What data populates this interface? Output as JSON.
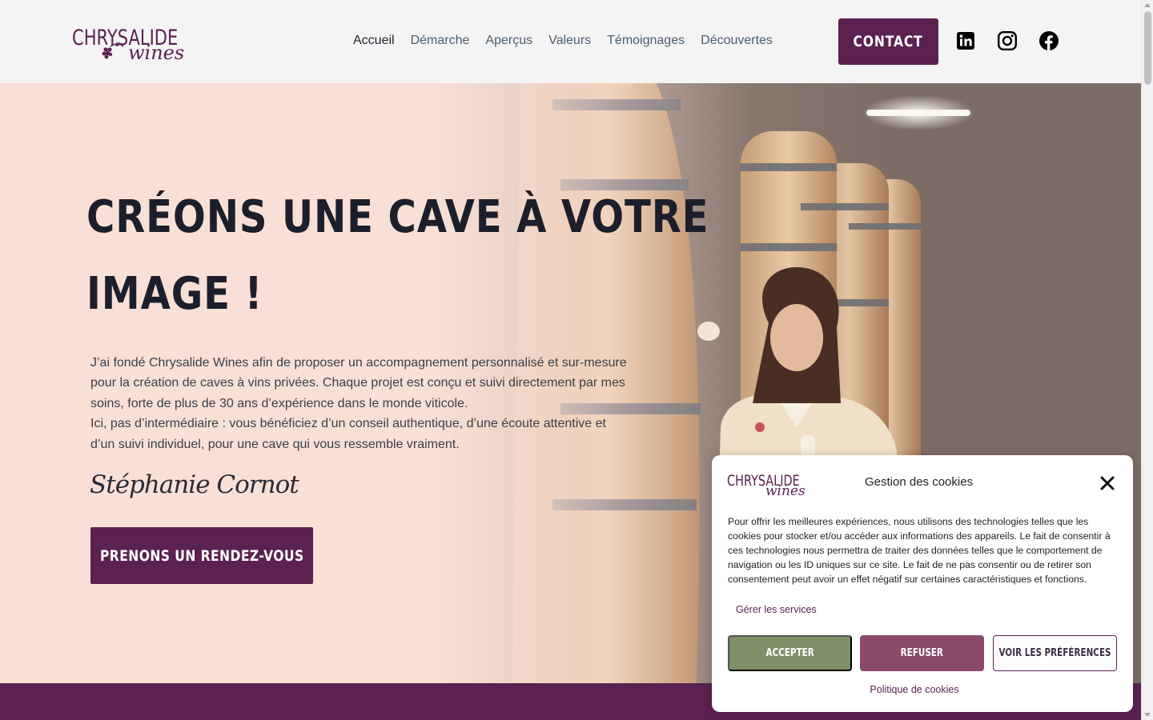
{
  "brand": {
    "logo_main": "CHRYSALIDE",
    "logo_script": "wines"
  },
  "nav": {
    "items": [
      {
        "label": "Accueil",
        "active": true
      },
      {
        "label": "Démarche"
      },
      {
        "label": "Aperçus"
      },
      {
        "label": "Valeurs"
      },
      {
        "label": "Témoignages"
      },
      {
        "label": "Découvertes"
      }
    ],
    "contact_label": "CONTACT"
  },
  "social": [
    "linkedin-icon",
    "instagram-icon",
    "facebook-icon"
  ],
  "hero": {
    "title_line1": "CRÉONS UNE CAVE À VOTRE",
    "title_line2": "IMAGE !",
    "paragraph_line1": "J’ai fondé Chrysalide Wines afin de proposer un accompagnement personnalisé et sur-mesure",
    "paragraph_line2": "pour la création de caves à vins privées. Chaque projet est conçu et suivi directement par mes",
    "paragraph_line3": "soins, forte de plus de 30 ans d’expérience dans le monde viticole.",
    "paragraph_line4": "Ici, pas d’intermédiaire : vous bénéficiez d’un conseil authentique, d’une écoute attentive et",
    "paragraph_line5": "d’un suivi individuel, pour une cave qui vous ressemble vraiment.",
    "signature": "Stéphanie Cornot",
    "cta_label": "PRENONS UN RENDEZ-VOUS"
  },
  "cookie": {
    "title": "Gestion des cookies",
    "body": "Pour offrir les meilleures expériences, nous utilisons des technologies telles que les cookies pour stocker et/ou accéder aux informations des appareils. Le fait de consentir à ces technologies nous permettra de traiter des données telles que le comportement de navigation ou les ID uniques sur ce site. Le fait de ne pas consentir ou de retirer son consentement peut avoir un effet négatif sur certaines caractéristiques et fonctions.",
    "manage_label": "Gérer les services",
    "accept_label": "ACCEPTER",
    "refuse_label": "REFUSER",
    "prefs_label": "VOIR LES PRÉFÉRENCES",
    "policy_label": "Politique de cookies"
  },
  "colors": {
    "brand_purple": "#5b2150",
    "hero_bg": "#f8ded4",
    "accept_green": "#7f8f67",
    "refuse_mauve": "#8c4a6b"
  }
}
